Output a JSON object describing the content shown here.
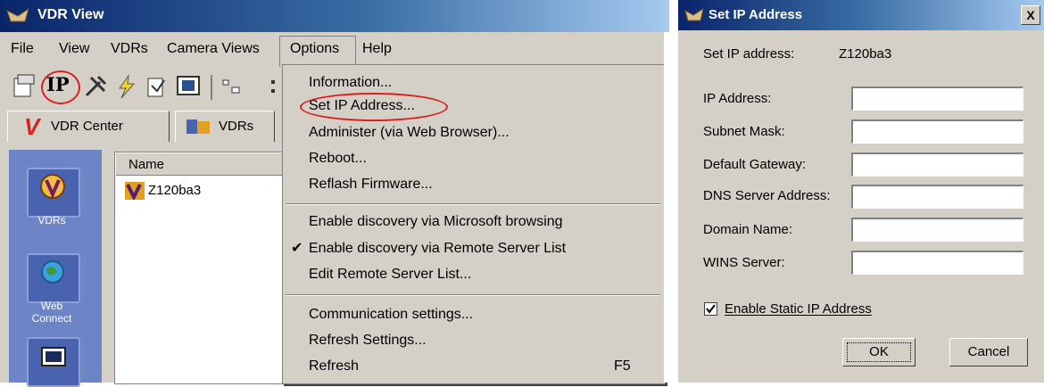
{
  "vdr_window": {
    "title": "VDR View",
    "menu": [
      "File",
      "View",
      "VDRs",
      "Camera Views",
      "Options",
      "Help"
    ],
    "toolbar": {
      "ip_label": "IP"
    },
    "tabs": [
      "VDR Center",
      "VDRs"
    ],
    "sidebar": [
      "VDRs",
      "Web Connect"
    ],
    "list": {
      "header": "Name",
      "items": [
        "Z120ba3"
      ]
    }
  },
  "options_menu": {
    "group1": [
      "Information...",
      "Set IP Address...",
      "Administer (via Web Browser)...",
      "Reboot...",
      "Reflash Firmware..."
    ],
    "group2": [
      "Enable discovery via Microsoft browsing",
      "Enable discovery via Remote Server List",
      "Edit Remote Server List..."
    ],
    "group3": [
      "Communication settings...",
      "Refresh Settings...",
      "Refresh"
    ],
    "refresh_shortcut": "F5",
    "checked_item": "Enable discovery via Remote Server List"
  },
  "ip_dialog": {
    "title": "Set IP Address",
    "close": "X",
    "target_label": "Set IP address:",
    "target_value": "Z120ba3",
    "fields": [
      {
        "label": "IP Address:",
        "value": ""
      },
      {
        "label": "Subnet Mask:",
        "value": ""
      },
      {
        "label": "Default Gateway:",
        "value": ""
      },
      {
        "label": "DNS Server Address:",
        "value": ""
      },
      {
        "label": "Domain Name:",
        "value": ""
      },
      {
        "label": "WINS Server:",
        "value": ""
      }
    ],
    "static_checkbox": {
      "label": "Enable Static IP Address",
      "checked": true
    },
    "ok": "OK",
    "cancel": "Cancel"
  },
  "colors": {
    "title_gradient_start": "#0a246a",
    "annotation_red": "#d9201c",
    "sidebar": "#6d85c7"
  }
}
